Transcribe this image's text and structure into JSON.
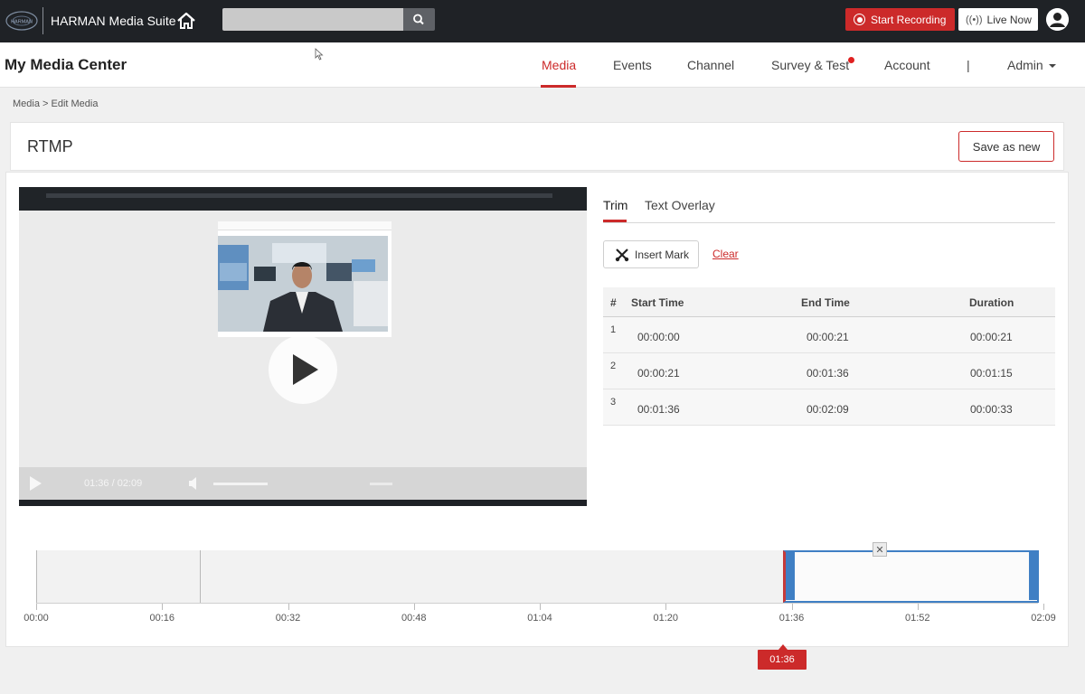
{
  "topbar": {
    "brand": "HARMAN Media Suite",
    "logo": "harman-logo",
    "search_placeholder": "",
    "record_label": "Start Recording",
    "live_label": "Live Now"
  },
  "header": {
    "title": "My Media Center",
    "nav": [
      {
        "label": "Media",
        "active": true
      },
      {
        "label": "Events"
      },
      {
        "label": "Channel"
      },
      {
        "label": "Survey & Test",
        "badge": true
      },
      {
        "label": "Account"
      },
      {
        "label": "|"
      },
      {
        "label": "Admin"
      }
    ]
  },
  "breadcrumb": "Media > Edit Media",
  "media": {
    "name": "RTMP",
    "save_label": "Save as new"
  },
  "player": {
    "time": "01:36 / 02:09"
  },
  "editor": {
    "tabs": [
      {
        "label": "Trim",
        "active": true
      },
      {
        "label": "Text Overlay"
      }
    ],
    "insert_mark_label": "Insert Mark",
    "clear_label": "Clear",
    "table": {
      "headers": [
        "#",
        "Start Time",
        "End Time",
        "Duration"
      ],
      "rows": [
        {
          "num": "1",
          "start": "00:00:00",
          "end": "00:00:21",
          "duration": "00:00:21"
        },
        {
          "num": "2",
          "start": "00:00:21",
          "end": "00:01:36",
          "duration": "00:01:15"
        },
        {
          "num": "3",
          "start": "00:01:36",
          "end": "00:02:09",
          "duration": "00:00:33"
        }
      ]
    }
  },
  "timeline": {
    "ticks": [
      "00:00",
      "00:16",
      "00:32",
      "00:48",
      "01:04",
      "01:20",
      "01:36",
      "01:52",
      "02:09"
    ],
    "playhead": "01:36",
    "close_glyph": "✕"
  },
  "colors": {
    "accent": "#cc2a2a",
    "topbar": "#1f2226",
    "segment": "#3f7fc4"
  }
}
